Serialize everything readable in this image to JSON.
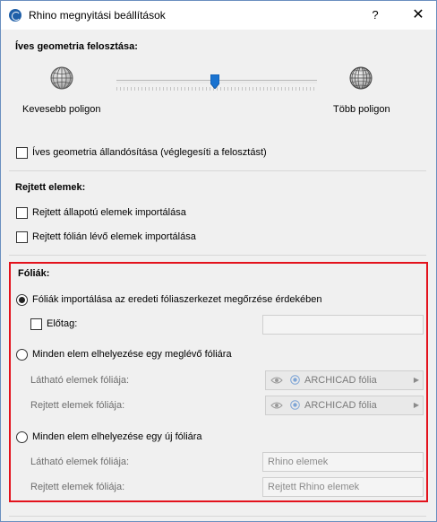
{
  "window": {
    "title": "Rhino megnyitási beállítások",
    "help_label": "?",
    "close_label": "✕"
  },
  "curved": {
    "heading": "Íves geometria felosztása:",
    "less_label": "Kevesebb poligon",
    "more_label": "Több poligon",
    "slider_level": 0.49,
    "keep_label": "Íves geometria állandósítása (véglegesíti a felosztást)"
  },
  "hidden": {
    "heading": "Rejtett elemek:",
    "import_state_label": "Rejtett állapotú elemek importálása",
    "import_layer_label": "Rejtett fólián lévő elemek importálása"
  },
  "layers": {
    "heading": "Fóliák:",
    "option1": "Fóliák importálása az eredeti fóliaszerkezet megőrzése érdekében",
    "prefix_label": "Előtag:",
    "prefix_value": "",
    "option2": "Minden elem elhelyezése egy meglévő fóliára",
    "visible_layer_label": "Látható elemek fóliája:",
    "hidden_layer_label": "Rejtett elemek fóliája:",
    "visible_layer_value": "ARCHICAD fólia",
    "hidden_layer_value": "ARCHICAD fólia",
    "option3": "Minden elem elhelyezése egy új fóliára",
    "new_visible_label": "Látható elemek fóliája:",
    "new_hidden_label": "Rejtett elemek fóliája:",
    "new_visible_value": "Rhino elemek",
    "new_hidden_value": "Rejtett Rhino elemek"
  },
  "icons": {
    "app": "archicad-icon",
    "globe": "globe-icon",
    "eye": "eye-icon",
    "layer": "target-icon",
    "dropdown": "chevron-right-icon"
  },
  "colors": {
    "highlight_border": "#e3121c",
    "slider_thumb": "#1a73d0"
  }
}
